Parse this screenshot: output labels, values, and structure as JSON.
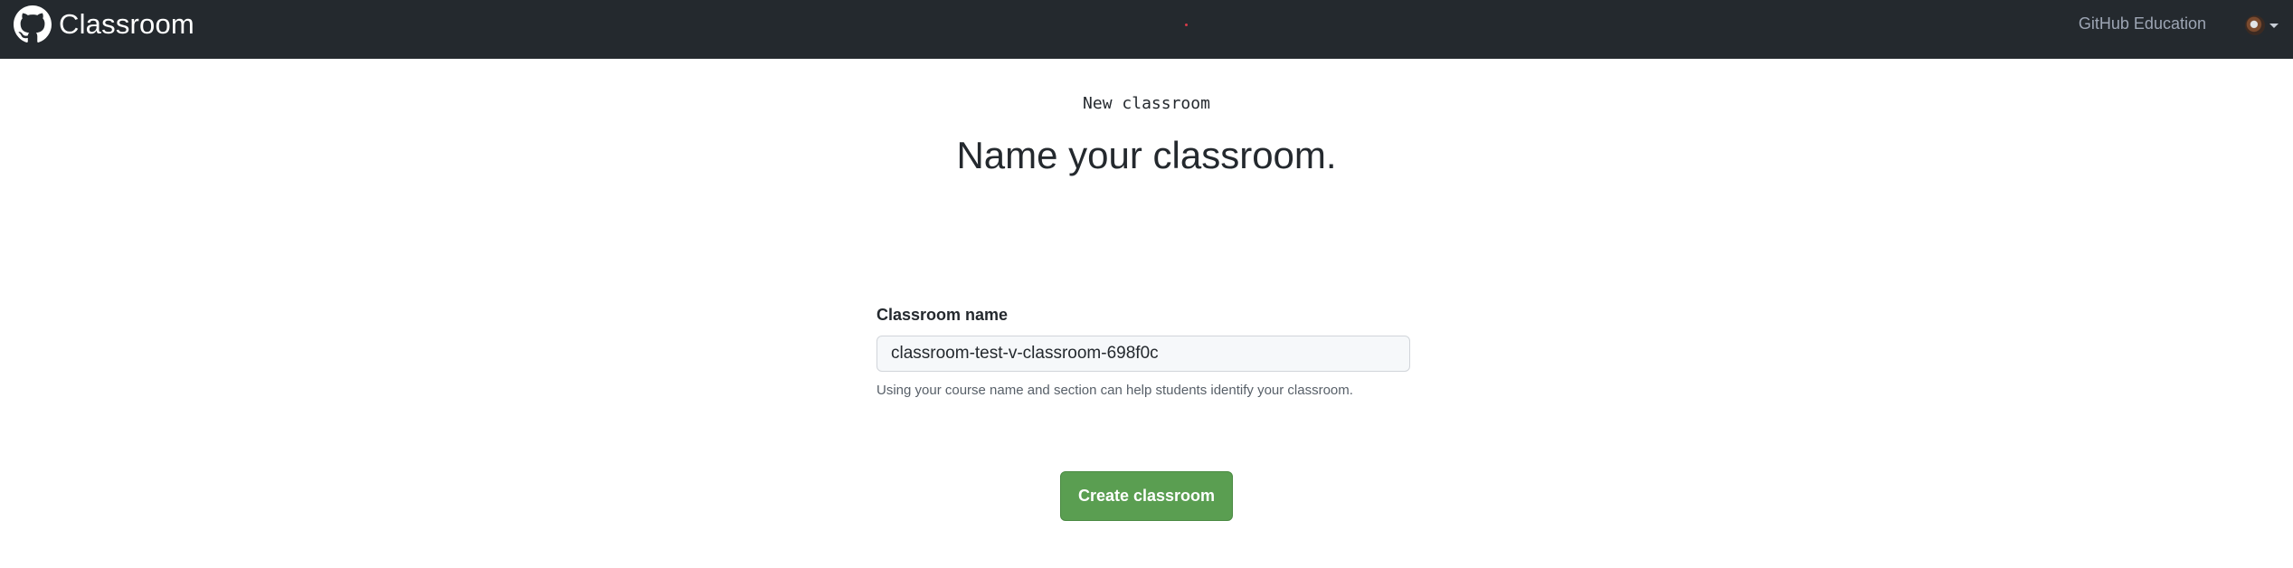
{
  "header": {
    "brand_name": "Classroom",
    "brand_icon": "github-octocat-icon",
    "nav_link": "GitHub Education",
    "avatar_icon": "user-avatar",
    "menu_icon": "caret-down-icon",
    "background_color": "#24292e"
  },
  "page": {
    "eyebrow": "New classroom",
    "headline": "Name your classroom."
  },
  "form": {
    "name_label": "Classroom name",
    "name_value": "classroom-test-v-classroom-698f0c",
    "hint": "Using your course name and section can help students identify your classroom.",
    "submit_label": "Create classroom",
    "submit_color": "#5a9e51"
  }
}
